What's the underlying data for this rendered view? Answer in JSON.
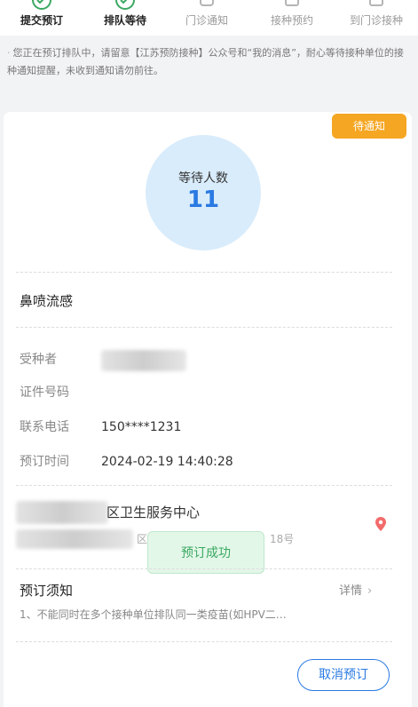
{
  "steps": [
    {
      "label": "提交预订",
      "status": "done"
    },
    {
      "label": "排队等待",
      "status": "done"
    },
    {
      "label": "门诊通知",
      "status": "todo"
    },
    {
      "label": "接种预约",
      "status": "todo"
    },
    {
      "label": "到门诊接种",
      "status": "todo"
    }
  ],
  "notice": {
    "bullet": "·",
    "text": "您正在预订排队中，请留意【江苏预防接种】公众号和“我的消息”，耐心等待接种单位的接种通知提醒，未收到通知请勿前往。"
  },
  "card": {
    "badge": "待通知",
    "wait_label": "等待人数",
    "wait_count": "11",
    "vaccine_name": "鼻喷流感",
    "rows": [
      {
        "label": "受种者",
        "value": ""
      },
      {
        "label": "证件号码",
        "value": ""
      },
      {
        "label": "联系电话",
        "value": "150****1231"
      },
      {
        "label": "预订时间",
        "value": "2024-02-19 14:40:28"
      }
    ],
    "clinic_name": "区卫生服务中心",
    "clinic_addr_part1": "区",
    "clinic_addr_part2": "18号",
    "toast": "预订成功",
    "notes_title": "预订须知",
    "detail_label": "详情",
    "detail_chevron": "›",
    "notes_text": "1、不能同时在多个接种单位排队同一类疫苗(如HPV二…",
    "cancel_label": "取消预订"
  },
  "colors": {
    "primary": "#2a7ae2",
    "step_done": "#3aa860",
    "badge": "#f5a623",
    "toast": "#3aa860"
  }
}
